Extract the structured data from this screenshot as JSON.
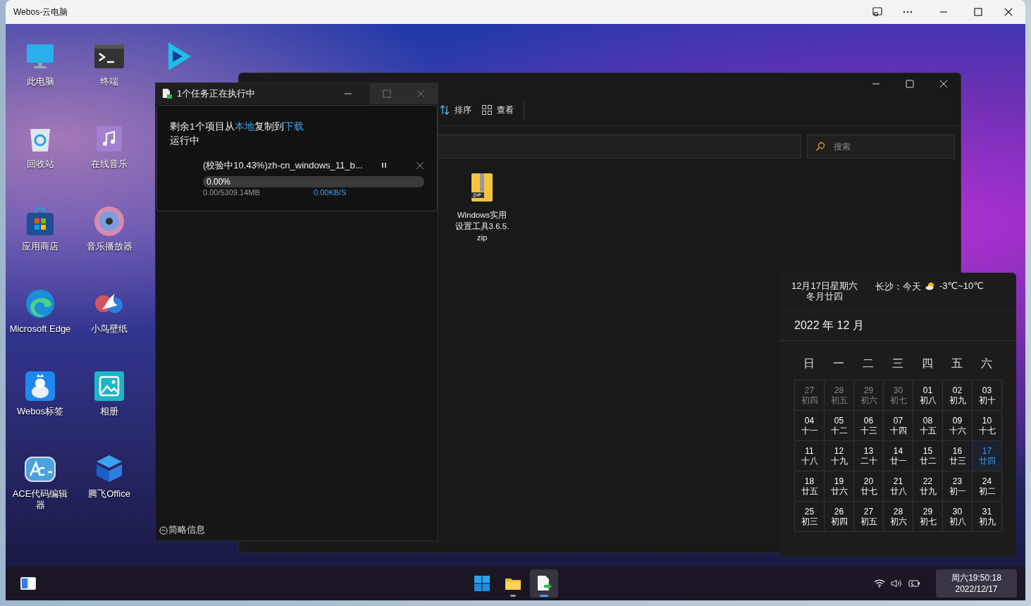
{
  "window": {
    "title": "Webos-云电脑"
  },
  "desktop_icons": [
    {
      "kind": "computer",
      "label": "此电脑"
    },
    {
      "kind": "recycle",
      "label": "回收站"
    },
    {
      "kind": "store",
      "label": "应用商店"
    },
    {
      "kind": "edge",
      "label": "Microsoft Edge"
    },
    {
      "kind": "note",
      "label": "Webos标签"
    },
    {
      "kind": "ace",
      "label": "ACE代码编辑器"
    },
    {
      "kind": "terminal",
      "label": "终端"
    },
    {
      "kind": "music",
      "label": "在线音乐"
    },
    {
      "kind": "player",
      "label": "音乐播放器"
    },
    {
      "kind": "bird",
      "label": "小鸟壁纸"
    },
    {
      "kind": "photos",
      "label": "相册"
    },
    {
      "kind": "office",
      "label": "腾飞Office"
    },
    {
      "kind": "video"
    }
  ],
  "explorer": {
    "toolbar": [
      {
        "kind": "sort",
        "label": "排序"
      },
      {
        "kind": "view",
        "label": "查看"
      }
    ],
    "search": {
      "placeholder": "搜索"
    },
    "files": [
      {
        "kind": "zip",
        "name": "Windows实用设置工具3.6.5.zip"
      }
    ]
  },
  "copy_dialog": {
    "title": "1个任务正在执行中",
    "summary_prefix": "剩余1个项目从",
    "source": "本地",
    "summary_middle": "复制到",
    "destination": "下载",
    "status": "运行中",
    "task": {
      "name": "(校验中10.43%)zh-cn_windows_11_b...",
      "percent": "0.00%",
      "level": 0,
      "size": "0.00/5309.14MB",
      "speed": "0.00KB/S"
    },
    "footer": "简略信息"
  },
  "calendar": {
    "date": "12月17日星期六",
    "lunar": "冬月廿四",
    "weather_place": "长沙：今天",
    "temperature": "-3℃~10℃",
    "month_title": "2022 年 12 月",
    "weekdays": [
      "日",
      "一",
      "二",
      "三",
      "四",
      "五",
      "六"
    ],
    "days": [
      {
        "day": "27",
        "lunar": "初四",
        "in_month": false,
        "selected": false
      },
      {
        "day": "28",
        "lunar": "初五",
        "in_month": false,
        "selected": false
      },
      {
        "day": "29",
        "lunar": "初六",
        "in_month": false,
        "selected": false
      },
      {
        "day": "30",
        "lunar": "初七",
        "in_month": false,
        "selected": false
      },
      {
        "day": "01",
        "lunar": "初八",
        "in_month": true,
        "selected": false
      },
      {
        "day": "02",
        "lunar": "初九",
        "in_month": true,
        "selected": false
      },
      {
        "day": "03",
        "lunar": "初十",
        "in_month": true,
        "selected": false
      },
      {
        "day": "04",
        "lunar": "十一",
        "in_month": true,
        "selected": false
      },
      {
        "day": "05",
        "lunar": "十二",
        "in_month": true,
        "selected": false
      },
      {
        "day": "06",
        "lunar": "十三",
        "in_month": true,
        "selected": false
      },
      {
        "day": "07",
        "lunar": "十四",
        "in_month": true,
        "selected": false
      },
      {
        "day": "08",
        "lunar": "十五",
        "in_month": true,
        "selected": false
      },
      {
        "day": "09",
        "lunar": "十六",
        "in_month": true,
        "selected": false
      },
      {
        "day": "10",
        "lunar": "十七",
        "in_month": true,
        "selected": false
      },
      {
        "day": "11",
        "lunar": "十八",
        "in_month": true,
        "selected": false
      },
      {
        "day": "12",
        "lunar": "十九",
        "in_month": true,
        "selected": false
      },
      {
        "day": "13",
        "lunar": "二十",
        "in_month": true,
        "selected": false
      },
      {
        "day": "14",
        "lunar": "廿一",
        "in_month": true,
        "selected": false
      },
      {
        "day": "15",
        "lunar": "廿二",
        "in_month": true,
        "selected": false
      },
      {
        "day": "16",
        "lunar": "廿三",
        "in_month": true,
        "selected": false
      },
      {
        "day": "17",
        "lunar": "廿四",
        "in_month": true,
        "selected": true
      },
      {
        "day": "18",
        "lunar": "廿五",
        "in_month": true,
        "selected": false
      },
      {
        "day": "19",
        "lunar": "廿六",
        "in_month": true,
        "selected": false
      },
      {
        "day": "20",
        "lunar": "廿七",
        "in_month": true,
        "selected": false
      },
      {
        "day": "21",
        "lunar": "廿八",
        "in_month": true,
        "selected": false
      },
      {
        "day": "22",
        "lunar": "廿九",
        "in_month": true,
        "selected": false
      },
      {
        "day": "23",
        "lunar": "初一",
        "in_month": true,
        "selected": false
      },
      {
        "day": "24",
        "lunar": "初二",
        "in_month": true,
        "selected": false
      },
      {
        "day": "25",
        "lunar": "初三",
        "in_month": true,
        "selected": false
      },
      {
        "day": "26",
        "lunar": "初四",
        "in_month": true,
        "selected": false
      },
      {
        "day": "27",
        "lunar": "初五",
        "in_month": true,
        "selected": false
      },
      {
        "day": "28",
        "lunar": "初六",
        "in_month": true,
        "selected": false
      },
      {
        "day": "29",
        "lunar": "初七",
        "in_month": true,
        "selected": false
      },
      {
        "day": "30",
        "lunar": "初八",
        "in_month": true,
        "selected": false
      },
      {
        "day": "31",
        "lunar": "初九",
        "in_month": true,
        "selected": false
      }
    ]
  },
  "taskbar": {
    "apps": [
      {
        "kind": "start",
        "running": false,
        "active": false
      },
      {
        "kind": "folder",
        "running": true,
        "active": false
      },
      {
        "kind": "copy",
        "running": true,
        "active": true
      }
    ],
    "clock": {
      "time": "周六19:50:18",
      "date": "2022/12/17"
    }
  }
}
